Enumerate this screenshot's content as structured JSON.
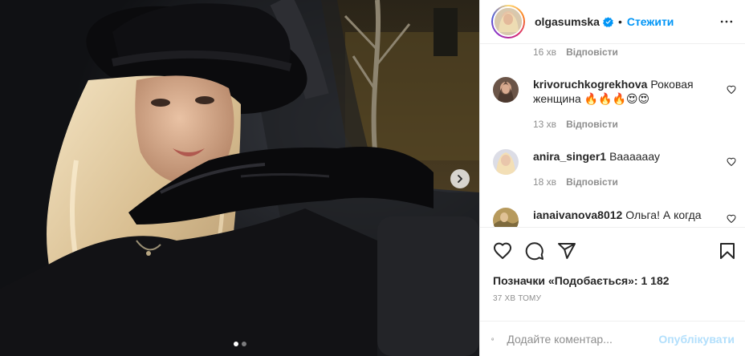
{
  "post": {
    "image_alt": "Selfie of a blonde woman in a black wide-brim hat and black satin gloves inside a car at night",
    "carousel": {
      "slide_count": 2,
      "active_index": 0
    }
  },
  "header": {
    "username": "olgasumska",
    "bullet": "•",
    "follow_label": "Стежити",
    "verified": true
  },
  "comments": {
    "top_meta": {
      "time": "16 хв",
      "reply_label": "Відповісти"
    },
    "items": [
      {
        "username": "krivoruchkogrekhova",
        "text": "Роковая женщина 🔥🔥🔥😍😍",
        "time": "13 хв",
        "reply_label": "Відповісти"
      },
      {
        "username": "anira_singer1",
        "text": "Ваааааау",
        "time": "18 хв",
        "reply_label": "Відповісти"
      },
      {
        "username": "ianaivanova8012",
        "text": "Ольга! А когда же",
        "time": "",
        "reply_label": ""
      }
    ]
  },
  "actions": {
    "icons": [
      "heart-icon",
      "comment-icon",
      "share-icon",
      "bookmark-icon"
    ]
  },
  "likes_text": "Позначки «Подобається»: 1 182",
  "time_ago": "37 ХВ ТОМУ",
  "add_comment": {
    "placeholder": "Додайте коментар...",
    "post_label": "Опублікувати"
  },
  "colors": {
    "accent": "#0095f6",
    "post_disabled": "#b2dffc",
    "text": "#262626",
    "muted": "#8e8e8e"
  }
}
